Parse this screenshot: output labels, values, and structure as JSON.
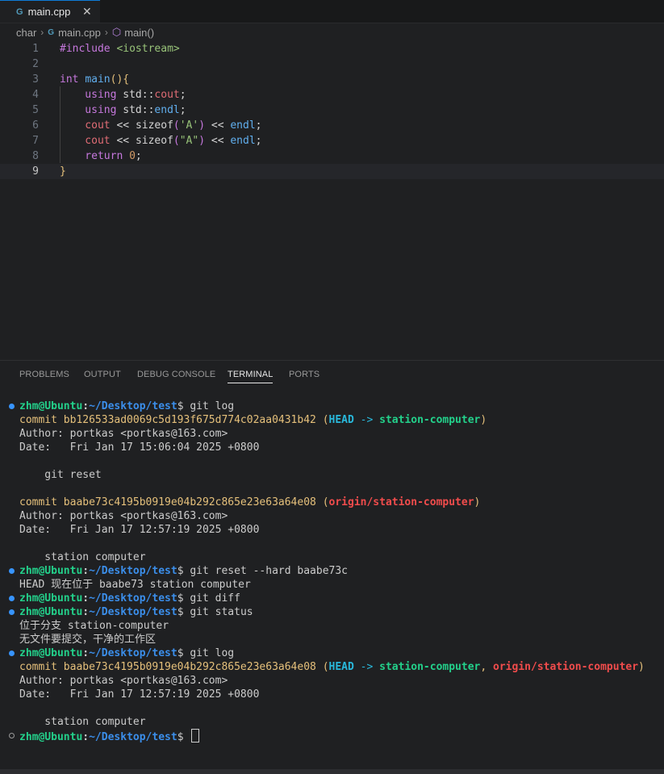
{
  "colors": {
    "keyword": "#c678dd",
    "func": "#61afef",
    "string": "#98c379",
    "number": "#d19a66",
    "variable": "#e06c75",
    "bracket": "#e5c07b",
    "bracket2": "#c678dd",
    "prompt_user": "#23d18b",
    "prompt_path": "#3b8eea",
    "commit": "#e5c07b",
    "head": "#29b8db",
    "branch_local": "#23d18b",
    "branch_remote": "#f14c4c"
  },
  "tab": {
    "icon": "cpp-icon",
    "label": "main.cpp",
    "close": "✕"
  },
  "breadcrumb": {
    "folder": "char",
    "file": "main.cpp",
    "symbol": "main()"
  },
  "editor": {
    "lines": [
      {
        "n": "1",
        "tokens": [
          {
            "t": "#include ",
            "c": "keyword"
          },
          {
            "t": "<iostream>",
            "c": "string"
          }
        ]
      },
      {
        "n": "2",
        "tokens": []
      },
      {
        "n": "3",
        "tokens": [
          {
            "t": "int ",
            "c": "keyword"
          },
          {
            "t": "main",
            "c": "func"
          },
          {
            "t": "(){",
            "c": "bracket"
          }
        ]
      },
      {
        "n": "4",
        "tokens": [
          {
            "t": "    using ",
            "c": "keyword"
          },
          {
            "t": "std",
            "c": ""
          },
          {
            "t": "::",
            "c": ""
          },
          {
            "t": "cout",
            "c": "variable"
          },
          {
            "t": ";",
            "c": ""
          }
        ]
      },
      {
        "n": "5",
        "tokens": [
          {
            "t": "    using ",
            "c": "keyword"
          },
          {
            "t": "std",
            "c": ""
          },
          {
            "t": "::",
            "c": ""
          },
          {
            "t": "endl",
            "c": "func"
          },
          {
            "t": ";",
            "c": ""
          }
        ]
      },
      {
        "n": "6",
        "tokens": [
          {
            "t": "    cout",
            "c": "variable"
          },
          {
            "t": " << ",
            "c": ""
          },
          {
            "t": "sizeof",
            "c": ""
          },
          {
            "t": "(",
            "c": "bracket2"
          },
          {
            "t": "'A'",
            "c": "string"
          },
          {
            "t": ")",
            "c": "bracket2"
          },
          {
            "t": " << ",
            "c": ""
          },
          {
            "t": "endl",
            "c": "func"
          },
          {
            "t": ";",
            "c": ""
          }
        ]
      },
      {
        "n": "7",
        "tokens": [
          {
            "t": "    cout",
            "c": "variable"
          },
          {
            "t": " << ",
            "c": ""
          },
          {
            "t": "sizeof",
            "c": ""
          },
          {
            "t": "(",
            "c": "bracket2"
          },
          {
            "t": "\"A\"",
            "c": "string"
          },
          {
            "t": ")",
            "c": "bracket2"
          },
          {
            "t": " << ",
            "c": ""
          },
          {
            "t": "endl",
            "c": "func"
          },
          {
            "t": ";",
            "c": ""
          }
        ]
      },
      {
        "n": "8",
        "tokens": [
          {
            "t": "    return ",
            "c": "keyword"
          },
          {
            "t": "0",
            "c": "number"
          },
          {
            "t": ";",
            "c": ""
          }
        ]
      },
      {
        "n": "9",
        "tokens": [
          {
            "t": "}",
            "c": "bracket"
          }
        ]
      }
    ]
  },
  "panel": {
    "tabs": [
      {
        "label": "PROBLEMS"
      },
      {
        "label": "OUTPUT"
      },
      {
        "label": "DEBUG CONSOLE"
      },
      {
        "label": "TERMINAL",
        "active": true
      },
      {
        "label": "PORTS"
      }
    ]
  },
  "terminal": {
    "lines": [
      {
        "dot": "filled",
        "prompt": true,
        "cmd": " git log"
      },
      {
        "segs": [
          {
            "t": "commit bb126533ad0069c5d193f675d774c02aa0431b42 ",
            "c": "commit"
          },
          {
            "t": "(",
            "c": "commit"
          },
          {
            "t": "HEAD",
            "c": "head",
            "b": true
          },
          {
            "t": " -> ",
            "c": "head"
          },
          {
            "t": "station-computer",
            "c": "branch_local",
            "b": true
          },
          {
            "t": ")",
            "c": "commit"
          }
        ]
      },
      {
        "segs": [
          {
            "t": "Author: portkas <portkas@163.com>"
          }
        ]
      },
      {
        "segs": [
          {
            "t": "Date:   Fri Jan 17 15:06:04 2025 +0800"
          }
        ]
      },
      {
        "segs": []
      },
      {
        "segs": [
          {
            "t": "    git reset"
          }
        ]
      },
      {
        "segs": []
      },
      {
        "segs": [
          {
            "t": "commit baabe73c4195b0919e04b292c865e23e63a64e08 ",
            "c": "commit"
          },
          {
            "t": "(",
            "c": "commit"
          },
          {
            "t": "origin/station-computer",
            "c": "branch_remote",
            "b": true
          },
          {
            "t": ")",
            "c": "commit"
          }
        ]
      },
      {
        "segs": [
          {
            "t": "Author: portkas <portkas@163.com>"
          }
        ]
      },
      {
        "segs": [
          {
            "t": "Date:   Fri Jan 17 12:57:19 2025 +0800"
          }
        ]
      },
      {
        "segs": []
      },
      {
        "segs": [
          {
            "t": "    station computer"
          }
        ]
      },
      {
        "dot": "filled",
        "prompt": true,
        "cmd": " git reset --hard baabe73c"
      },
      {
        "segs": [
          {
            "t": "HEAD 现在位于 baabe73 station computer"
          }
        ]
      },
      {
        "dot": "filled",
        "prompt": true,
        "cmd": " git diff"
      },
      {
        "dot": "filled",
        "prompt": true,
        "cmd": " git status"
      },
      {
        "segs": [
          {
            "t": "位于分支 station-computer"
          }
        ]
      },
      {
        "segs": [
          {
            "t": "无文件要提交，干净的工作区"
          }
        ]
      },
      {
        "dot": "filled",
        "prompt": true,
        "cmd": " git log"
      },
      {
        "segs": [
          {
            "t": "commit baabe73c4195b0919e04b292c865e23e63a64e08 ",
            "c": "commit"
          },
          {
            "t": "(",
            "c": "commit"
          },
          {
            "t": "HEAD",
            "c": "head",
            "b": true
          },
          {
            "t": " -> ",
            "c": "head"
          },
          {
            "t": "station-computer",
            "c": "branch_local",
            "b": true
          },
          {
            "t": ", ",
            "c": "commit"
          },
          {
            "t": "origin/station-computer",
            "c": "branch_remote",
            "b": true
          },
          {
            "t": ")",
            "c": "commit"
          }
        ]
      },
      {
        "segs": [
          {
            "t": "Author: portkas <portkas@163.com>"
          }
        ]
      },
      {
        "segs": [
          {
            "t": "Date:   Fri Jan 17 12:57:19 2025 +0800"
          }
        ]
      },
      {
        "segs": []
      },
      {
        "segs": [
          {
            "t": "    station computer"
          }
        ]
      },
      {
        "dot": "empty",
        "prompt": true,
        "cmd": " ",
        "cursor": true
      }
    ],
    "prompt": {
      "user": "zhm@Ubuntu",
      "sep": ":",
      "path": "~/Desktop/test",
      "sym": "$"
    }
  }
}
